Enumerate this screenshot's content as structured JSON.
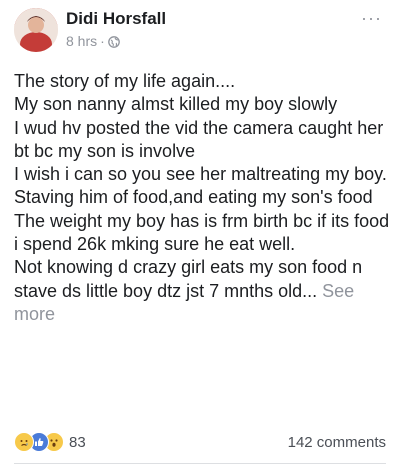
{
  "post": {
    "author": "Didi Horsfall",
    "time": "8 hrs",
    "separator": "·",
    "privacy_icon": "globe-icon",
    "more_icon": "ellipsis-icon",
    "more_label": "···",
    "lines": [
      "The story of my life again....",
      "My son nanny almst killed my boy slowly",
      "I wud hv posted the vid the camera caught her bt bc my son is involve",
      "I wish i can so you see her maltreating my boy.",
      "Staving him of food,and eating my son's food",
      "The weight my boy has is frm birth bc if its food i spend 26k mking sure he eat well.",
      "Not knowing d crazy girl eats my son food n stave ds little boy dtz jst 7 mnths old..."
    ],
    "see_more": "See more"
  },
  "stats": {
    "reaction_icons": [
      "sad-reaction-icon",
      "like-reaction-icon",
      "wow-reaction-icon"
    ],
    "reaction_count": "83",
    "comments": "142 comments"
  },
  "colors": {
    "text": "#1c1e21",
    "muted": "#90949c",
    "like_blue": "#4a7bd8",
    "emoji_yellow": "#f7c94a"
  }
}
